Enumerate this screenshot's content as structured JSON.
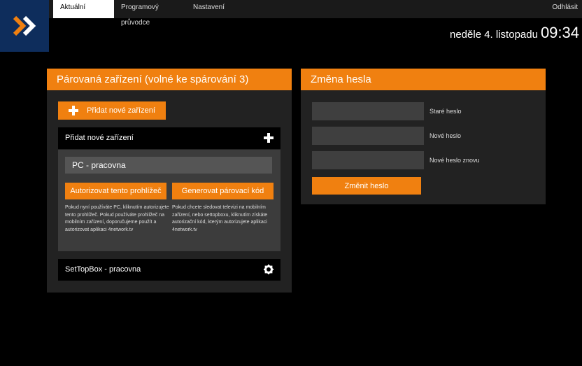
{
  "header": {
    "tabs": [
      "Aktuální pořady",
      "Programový průvodce",
      "Nastavení"
    ],
    "logout_label": "Odhlásit",
    "date": "neděle 4. listopadu",
    "time": "09:34"
  },
  "devices_panel": {
    "title": "Párovaná zařízení (volné ke spárování 3)",
    "add_button_label": "Přidat nové zařízení",
    "add_section_title": "Přidat nové zařízení",
    "device_name": "PC - pracovna",
    "authorize_button_label": "Autorizovat tento prohlížeč",
    "generate_button_label": "Generovat párovací kód",
    "authorize_help": "Pokud nyní používáte PC, kliknutím autorizujete tento prohlížeč. Pokud používáte prohlížeč na mobilním zařízení, doporučujeme použít a autorizovat aplikaci 4network.tv",
    "generate_help": "Pokud chcete sledovat televizi na mobilním zařízení, nebo settopboxu, kliknutím získáte autorizační kód, kterým autorizujete aplikaci 4network.tv",
    "stb_name": "SetTopBox - pracovna"
  },
  "password_panel": {
    "title": "Změna hesla",
    "old_label": "Staré heslo",
    "new_label": "Nové heslo",
    "repeat_label": "Nové heslo znovu",
    "submit_label": "Změnit heslo"
  },
  "colors": {
    "accent": "#f08010",
    "logo_bg": "#0e2d5c"
  },
  "icons": [
    "logo-chevron-icon",
    "plus-icon",
    "gear-icon"
  ]
}
